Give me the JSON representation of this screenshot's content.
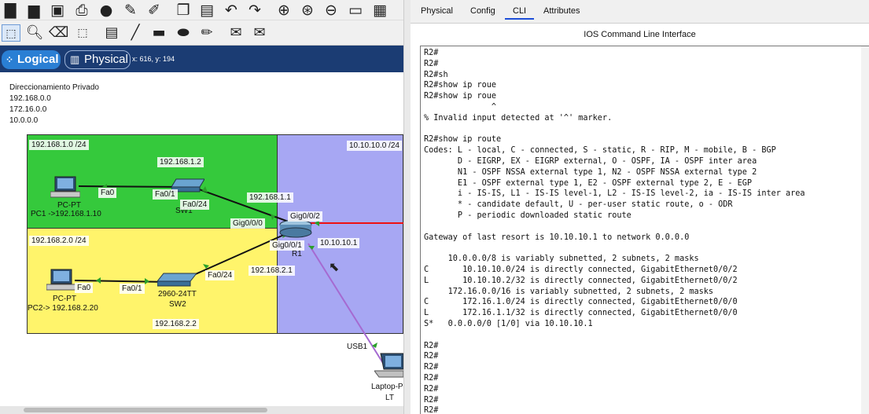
{
  "toolbar": {
    "icons": [
      "new-file-icon",
      "open-folder-icon",
      "save-icon",
      "print-icon",
      "info-icon",
      "network-wizard-icon",
      "activity-wizard-icon",
      "copy-icon",
      "paste-icon",
      "undo-icon",
      "redo-icon",
      "zoom-in-icon",
      "zoom-reset-icon",
      "zoom-out-icon",
      "drawing-palette-icon",
      "custom-device-icon"
    ],
    "tools": [
      "select-icon",
      "inspect-icon",
      "delete-icon",
      "resize-icon",
      "note-icon",
      "line-icon",
      "rectangle-icon",
      "ellipse-icon",
      "freeform-icon",
      "simple-pdu-icon",
      "complex-pdu-icon"
    ]
  },
  "view": {
    "logical_label": "Logical",
    "physical_label": "Physical",
    "coords": "x: 616, y: 194"
  },
  "canvas": {
    "note_lines": [
      "Direccionamiento Privado",
      "192.168.0.0",
      "172.16.0.0",
      "10.0.0.0"
    ],
    "zones": {
      "green": {
        "label": "192.168.1.0 /24",
        "color": "#35c93c"
      },
      "yellow": {
        "label": "192.168.2.0 /24",
        "color": "#fff46b"
      },
      "blue": {
        "label": "10.10.10.0 /24",
        "color": "#a7a7f3"
      }
    },
    "labels": {
      "sw1_ip": "192.168.1.2",
      "r1_g000_ip": "192.168.1.1",
      "r1_g001_ip": "192.168.2.1",
      "r1_g002_ip": "10.10.10.1",
      "sw2_ip": "192.168.2.2",
      "pc1_type": "PC-PT",
      "pc1_name": "PC1 ->192.168.1.10",
      "pc2_type": "PC-PT",
      "pc2_name": "PC2-> 192.168.2.20",
      "sw1_name": "SW1",
      "sw2_model": "2960-24TT",
      "sw2_name": "SW2",
      "r1_name": "R1",
      "laptop_type": "Laptop-P",
      "laptop_name": "LT",
      "fa0_pc1": "Fa0",
      "fa01_sw1": "Fa0/1",
      "fa024_sw1": "Fa0/24",
      "gig000": "Gig0/0/0",
      "gig002": "Gig0/0/2",
      "gig001": "Gig0/0/1",
      "fa0_pc2": "Fa0",
      "fa01_sw2": "Fa0/1",
      "fa024_sw2": "Fa0/24",
      "usb1": "USB1"
    }
  },
  "right_panel": {
    "tabs": [
      "Physical",
      "Config",
      "CLI",
      "Attributes"
    ],
    "active_tab": "CLI",
    "title": "IOS Command Line Interface",
    "cli_text": "R2#\nR2#\nR2#sh\nR2#show ip roue\nR2#show ip roue\n              ^\n% Invalid input detected at '^' marker.\n\nR2#show ip route\nCodes: L - local, C - connected, S - static, R - RIP, M - mobile, B - BGP\n       D - EIGRP, EX - EIGRP external, O - OSPF, IA - OSPF inter area\n       N1 - OSPF NSSA external type 1, N2 - OSPF NSSA external type 2\n       E1 - OSPF external type 1, E2 - OSPF external type 2, E - EGP\n       i - IS-IS, L1 - IS-IS level-1, L2 - IS-IS level-2, ia - IS-IS inter area\n       * - candidate default, U - per-user static route, o - ODR\n       P - periodic downloaded static route\n\nGateway of last resort is 10.10.10.1 to network 0.0.0.0\n\n     10.0.0.0/8 is variably subnetted, 2 subnets, 2 masks\nC       10.10.10.0/24 is directly connected, GigabitEthernet0/0/2\nL       10.10.10.2/32 is directly connected, GigabitEthernet0/0/2\n     172.16.0.0/16 is variably subnetted, 2 subnets, 2 masks\nC       172.16.1.0/24 is directly connected, GigabitEthernet0/0/0\nL       172.16.1.1/32 is directly connected, GigabitEthernet0/0/0\nS*   0.0.0.0/0 [1/0] via 10.10.10.1\n\nR2#\nR2#\nR2#\nR2#\nR2#\nR2#\nR2#"
  }
}
